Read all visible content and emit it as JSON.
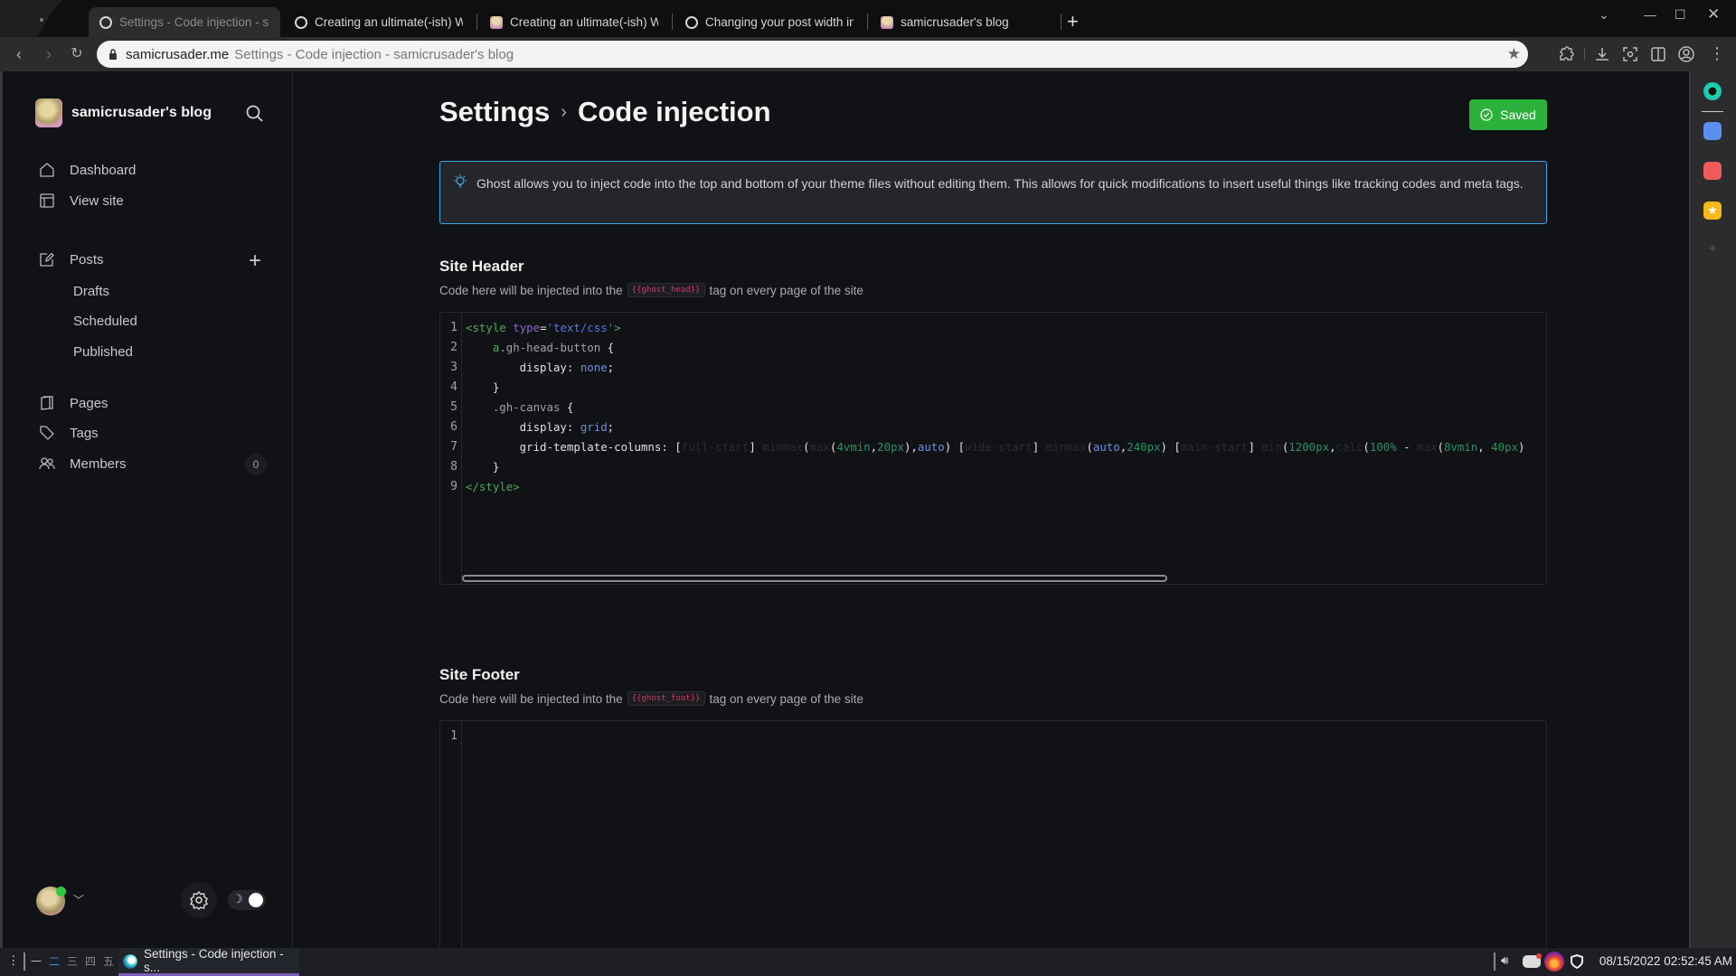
{
  "browser": {
    "tabs": [
      {
        "label": "Settings - Code injection - samicrusader's blog",
        "active": true,
        "favicon": "circle-icon"
      },
      {
        "label": "Creating an ultimate(-ish) Wi",
        "favicon": "circle-icon"
      },
      {
        "label": "Creating an ultimate(-ish) Wi",
        "favicon": "avatar-favicon"
      },
      {
        "label": "Changing your post width in",
        "favicon": "circle-icon"
      },
      {
        "label": "samicrusader's blog",
        "favicon": "avatar-favicon"
      }
    ],
    "new_tab": "+",
    "url_domain": "samicrusader.me",
    "url_rest": "Settings - Code injection - samicrusader's blog"
  },
  "sidebar": {
    "site_name": "samicrusader's blog",
    "items": [
      {
        "label": "Dashboard",
        "icon": "home-icon"
      },
      {
        "label": "View site",
        "icon": "layout-icon"
      },
      {
        "label": "Posts",
        "icon": "edit-icon"
      },
      {
        "label": "Pages",
        "icon": "pages-icon"
      },
      {
        "label": "Tags",
        "icon": "tag-icon"
      },
      {
        "label": "Members",
        "icon": "members-icon",
        "count": "0"
      }
    ],
    "post_subitems": [
      "Drafts",
      "Scheduled",
      "Published"
    ],
    "plus": "+",
    "moon": "☽"
  },
  "main": {
    "breadcrumb_parent": "Settings",
    "breadcrumb_sep": "›",
    "page_title": "Code injection",
    "saved_label": "Saved",
    "info_text": "Ghost allows you to inject code into the top and bottom of your theme files without editing them. This allows for quick modifications to insert useful things like tracking codes and meta tags.",
    "header_section": {
      "title": "Site Header",
      "desc_before": "Code here will be injected into the",
      "tag": "{{ghost_head}}",
      "desc_after": "tag on every page of the site",
      "line_numbers": [
        "1",
        "2",
        "3",
        "4",
        "5",
        "6",
        "7",
        "8",
        "9"
      ],
      "code_lines": [
        "<style type='text/css'>",
        "    a.gh-head-button {",
        "        display: none;",
        "    }",
        "    .gh-canvas {",
        "        display: grid;",
        "        grid-template-columns: [full-start] minmax(max(4vmin,20px),auto) [wide-start] minmax(auto,240px) [main-start] min(1200px,calc(100% - max(8vmin, 40px)",
        "    }",
        "</style>"
      ]
    },
    "footer_section": {
      "title": "Site Footer",
      "desc_before": "Code here will be injected into the",
      "tag": "{{ghost_foot}}",
      "desc_after": "tag on every page of the site",
      "line_numbers": [
        "1"
      ]
    }
  },
  "taskbar": {
    "workspaces": [
      "一",
      "二",
      "三",
      "四",
      "五"
    ],
    "active_task": "Settings - Code injection - s...",
    "clock": "08/15/2022 02:52:45 AM"
  },
  "colors": {
    "accent_blue": "#3aa7e6",
    "saved_green": "#2cb13c",
    "tag_red": "#d23a68"
  }
}
